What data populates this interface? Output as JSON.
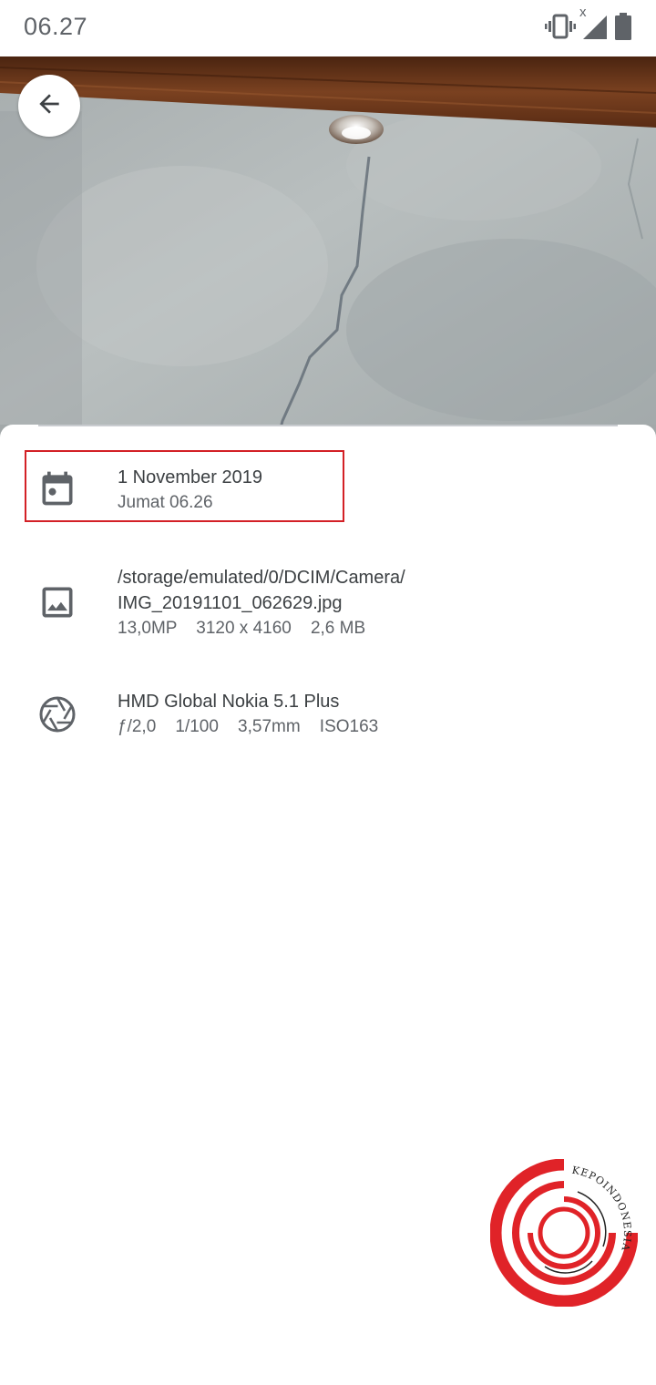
{
  "status_bar": {
    "time": "06.27",
    "icons": [
      "vibrate-icon",
      "no-signal-icon",
      "battery-icon"
    ],
    "signal_badge": "x"
  },
  "photo_viewer": {
    "back_icon": "arrow-back-icon"
  },
  "details": {
    "date": {
      "icon": "calendar-icon",
      "title": "1 November 2019",
      "subtitle": "Jumat 06.26"
    },
    "file": {
      "icon": "image-icon",
      "path_line1": "/storage/emulated/0/DCIM/Camera/",
      "path_line2": "IMG_20191101_062629.jpg",
      "meta": "13,0MP    3120 x 4160    2,6 MB"
    },
    "camera": {
      "icon": "camera-aperture-icon",
      "model": "HMD Global Nokia 5.1 Plus",
      "meta": "ƒ/2,0    1/100    3,57mm    ISO163"
    }
  },
  "watermark": {
    "text": "KEPOINDONESIA",
    "color": "#e02328"
  },
  "colors": {
    "highlight": "#d32026",
    "icon": "#5f6368",
    "text_primary": "#3c4043",
    "text_secondary": "#5f6368"
  }
}
